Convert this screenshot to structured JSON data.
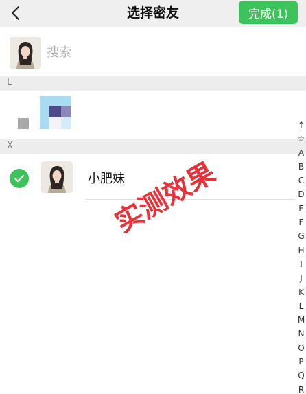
{
  "header": {
    "title": "选择密友",
    "done_label": "完成(1)",
    "back_icon": "chevron-left-icon"
  },
  "search": {
    "placeholder": "搜索",
    "value": ""
  },
  "sections": [
    {
      "letter": "L"
    },
    {
      "letter": "X"
    }
  ],
  "contacts": [
    {
      "name": "小肥妹",
      "selected": true
    }
  ],
  "index_bar": [
    "↑",
    "☆",
    "A",
    "B",
    "C",
    "D",
    "E",
    "F",
    "G",
    "H",
    "I",
    "J",
    "K",
    "L",
    "M",
    "N",
    "O",
    "P",
    "Q",
    "R"
  ],
  "watermark": "实测效果",
  "colors": {
    "accent": "#3ec25c",
    "watermark": "#e8323a",
    "header_bg": "#efefef",
    "section_bg": "#ededed"
  }
}
